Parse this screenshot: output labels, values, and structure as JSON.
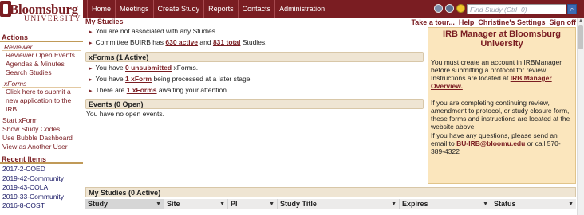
{
  "logo": {
    "word": "Bloomsburg",
    "sub": "UNIVERSITY"
  },
  "nav": {
    "items": [
      {
        "label": "Home"
      },
      {
        "label": "Meetings"
      },
      {
        "label": "Create Study"
      },
      {
        "label": "Reports"
      },
      {
        "label": "Contacts"
      },
      {
        "label": "Administration"
      }
    ]
  },
  "top_icons": [
    "user-icon",
    "user-group-icon",
    "smiley-icon",
    "settings-circle-icon"
  ],
  "search": {
    "placeholder": "Find Study (Ctrl+0)",
    "button_label": "⌕"
  },
  "header": {
    "page_title": "My Studies",
    "quick_links": [
      {
        "label": "Take a tour..."
      },
      {
        "label": "Help"
      },
      {
        "label": "Christine's Settings"
      },
      {
        "label": "Sign off"
      }
    ]
  },
  "sidebar": {
    "actions_header": "Actions",
    "reviewer_group": "Reviewer",
    "reviewer_links": [
      "Reviewer Open Events",
      "Agendas & Minutes",
      "Search Studies"
    ],
    "xforms_group": "xForms",
    "xforms_link": "Click here to submit a new application to the IRB",
    "other_links": [
      "Start xForm",
      "Show Study Codes",
      "Use Bubble Dashboard",
      "View as Another User"
    ],
    "recent_header": "Recent Items",
    "recent_items": [
      "2017-2-COED",
      "2019-42-Community",
      "2019-43-COLA",
      "2019-33-Community",
      "2016-8-COST"
    ]
  },
  "studies_panel": {
    "line1": "You are not associated with any Studies.",
    "line2_pre": "Committee BUIRB has ",
    "line2_active": "630 active",
    "line2_mid": " and ",
    "line2_total": "831 total",
    "line2_post": " Studies."
  },
  "xforms_panel": {
    "header": "xForms (1 Active)",
    "rows": [
      {
        "pre": "You have ",
        "link": "0 unsubmitted",
        "post": " xForms."
      },
      {
        "pre": "You have ",
        "link": "1 xForm",
        "post": " being processed at a later stage."
      },
      {
        "pre": "There are ",
        "link": "1 xForms",
        "post": " awaiting your attention."
      }
    ]
  },
  "events_panel": {
    "header": "Events (0 Open)",
    "body": "You have no open events."
  },
  "info_panel": {
    "title": "IRB Manager at Bloomsburg University",
    "p1_pre": "You must create an account in IRBManager before submitting a protocol for review. Instructions are located at ",
    "p1_link": "IRB Manager Overview.",
    "p2": "If you are completing continuing review, amendment to protocol, or study closure form, these forms and instructions are located at the website above.",
    "p3": "If you have any questions, please send an email to ",
    "p3_link": "BU-IRB@bloomu.edu",
    "p3_post": " or call 570-389-4322"
  },
  "my_studies_table": {
    "header": "My Studies (0 Active)",
    "columns": [
      "Study",
      "Site",
      "PI",
      "Study Title",
      "Expires",
      "Status"
    ],
    "sorted_column": "Study"
  },
  "colors": {
    "brand": "#7a1d22",
    "panel": "#efe5d3",
    "info_bg": "#fbe6bd"
  }
}
